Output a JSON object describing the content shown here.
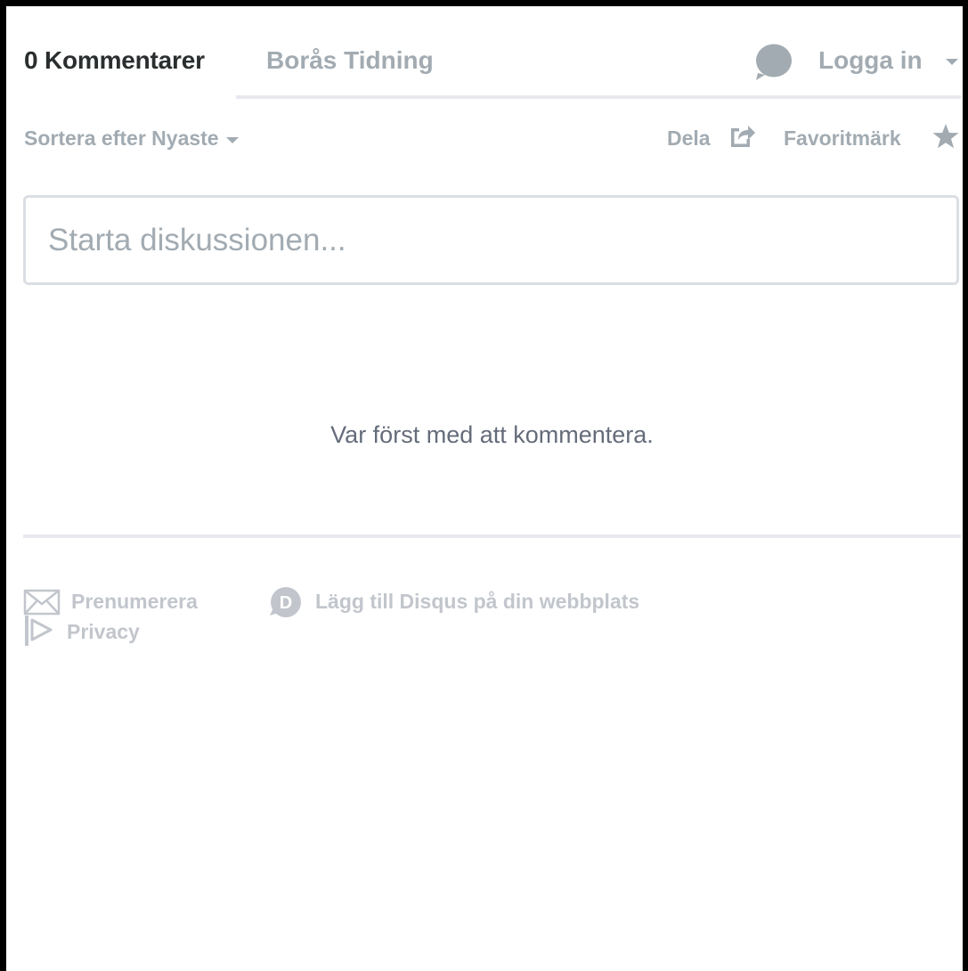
{
  "nav": {
    "comment_count": "0 Kommentarer",
    "forum_name": "Borås Tidning",
    "login_label": "Logga in"
  },
  "toolbar": {
    "sort_label": "Sortera efter Nyaste",
    "share_label": "Dela",
    "favorite_label": "Favoritmärk"
  },
  "composer": {
    "placeholder": "Starta diskussionen..."
  },
  "empty_state": {
    "message": "Var först med att kommentera."
  },
  "footer": {
    "subscribe_label": "Prenumerera",
    "add_disqus_label": "Lägg till Disqus på din webbplats",
    "privacy_label": "Privacy"
  },
  "icons": {
    "login_avatar": "speech-bubble-icon",
    "share": "share-icon",
    "favorite": "star-icon",
    "subscribe": "envelope-icon",
    "add_disqus": "disqus-logo-icon",
    "privacy": "privacy-icon"
  },
  "colors": {
    "primary_text": "#2a2e2e",
    "muted_text": "#a2abb2",
    "footer_text": "#c2c6cc",
    "divider": "#e7e9ee",
    "border": "#dbdfe4"
  }
}
